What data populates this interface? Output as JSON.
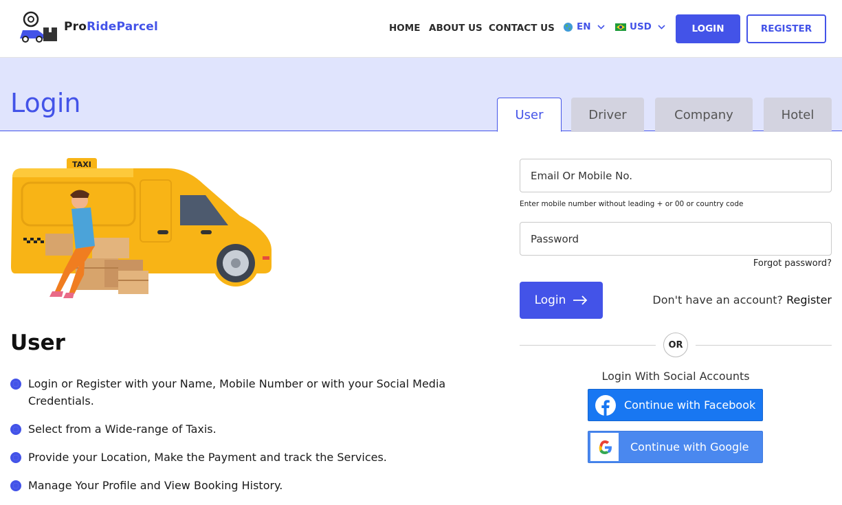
{
  "brand": {
    "name_part1": "Pro",
    "name_part2": "RideParcel"
  },
  "nav": {
    "items": [
      "HOME",
      "ABOUT US",
      "CONTACT US"
    ],
    "language": "EN",
    "currency": "USD",
    "login_label": "LOGIN",
    "register_label": "REGISTER"
  },
  "banner": {
    "title": "Login",
    "tabs": [
      "User",
      "Driver",
      "Company",
      "Hotel"
    ],
    "active_tab": "User"
  },
  "illustration": {
    "sign": "TAXI"
  },
  "info": {
    "heading": "User",
    "features": [
      "Login or Register with your Name, Mobile Number or with your Social Media Credentials.",
      "Select from a Wide-range of Taxis.",
      "Provide your Location, Make the Payment and track the Services.",
      "Manage Your Profile and View Booking History."
    ]
  },
  "form": {
    "email_placeholder": "Email Or Mobile No.",
    "email_hint": "Enter mobile number without leading + or 00 or country code",
    "password_placeholder": "Password",
    "forgot_label": "Forgot password?",
    "login_label": "Login",
    "no_account_text": "Don't have an account?",
    "register_link": "Register",
    "or_label": "OR",
    "social_label": "Login With Social Accounts",
    "facebook_label": "Continue with Facebook",
    "google_label": "Continue with Google"
  },
  "colors": {
    "accent": "#4353e8",
    "banner_bg": "#e0e4fd",
    "facebook": "#1877f2",
    "google": "#4a88ef"
  }
}
